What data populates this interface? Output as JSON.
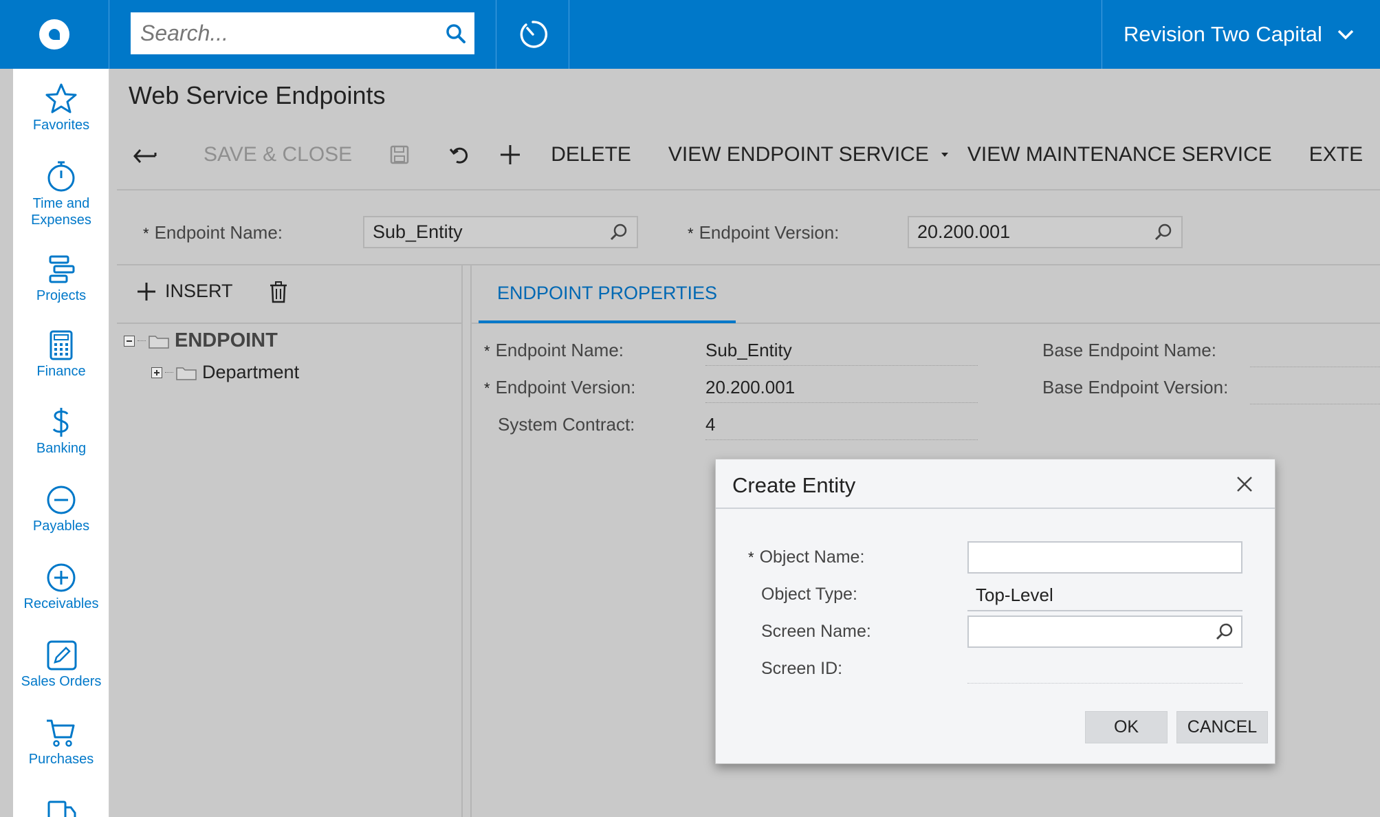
{
  "topbar": {
    "search_placeholder": "Search...",
    "company_name": "Revision Two Capital"
  },
  "leftnav": {
    "items": [
      {
        "label": "Favorites",
        "icon": "star-icon"
      },
      {
        "label_line1": "Time and",
        "label_line2": "Expenses",
        "icon": "stopwatch-icon"
      },
      {
        "label": "Projects",
        "icon": "projects-icon"
      },
      {
        "label": "Finance",
        "icon": "calculator-icon"
      },
      {
        "label": "Banking",
        "icon": "dollar-icon"
      },
      {
        "label": "Payables",
        "icon": "minus-circle-icon"
      },
      {
        "label": "Receivables",
        "icon": "plus-circle-icon"
      },
      {
        "label": "Sales Orders",
        "icon": "pencil-square-icon"
      },
      {
        "label": "Purchases",
        "icon": "cart-icon"
      }
    ]
  },
  "page": {
    "title": "Web Service Endpoints"
  },
  "toolbar": {
    "save_close": "SAVE & CLOSE",
    "delete": "DELETE",
    "view_endpoint_service": "VIEW ENDPOINT SERVICE",
    "view_maintenance_service": "VIEW MAINTENANCE SERVICE",
    "extend_truncated": "EXTE"
  },
  "header_form": {
    "endpoint_name_label": "Endpoint Name:",
    "endpoint_name_value": "Sub_Entity",
    "endpoint_version_label": "Endpoint Version:",
    "endpoint_version_value": "20.200.001"
  },
  "tree": {
    "insert_label": "INSERT",
    "root_label": "ENDPOINT",
    "child_label": "Department"
  },
  "tabs": {
    "active": "ENDPOINT PROPERTIES"
  },
  "properties": {
    "endpoint_name_label": "Endpoint Name:",
    "endpoint_name_value": "Sub_Entity",
    "endpoint_version_label": "Endpoint Version:",
    "endpoint_version_value": "20.200.001",
    "system_contract_label": "System Contract:",
    "system_contract_value": "4",
    "base_endpoint_name_label": "Base Endpoint Name:",
    "base_endpoint_version_label": "Base Endpoint Version:"
  },
  "dialog": {
    "title": "Create Entity",
    "object_name_label": "Object Name:",
    "object_name_value": "",
    "object_type_label": "Object Type:",
    "object_type_value": "Top-Level",
    "screen_name_label": "Screen Name:",
    "screen_name_value": "",
    "screen_id_label": "Screen ID:",
    "ok_label": "OK",
    "cancel_label": "CANCEL"
  },
  "colors": {
    "brand": "#0078c9",
    "background": "#c9c9c9",
    "dialog_bg": "#f4f5f7"
  }
}
